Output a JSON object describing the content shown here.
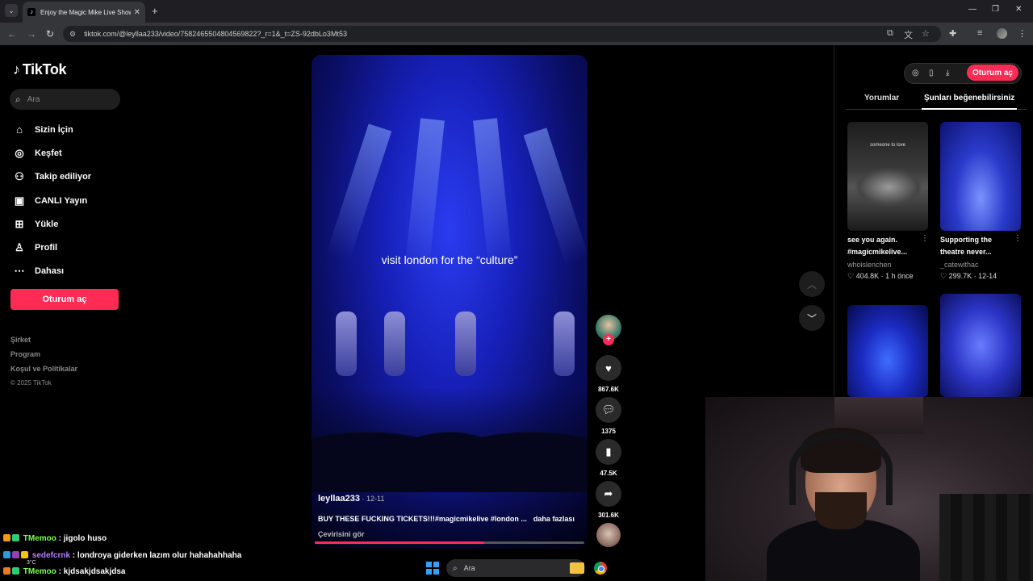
{
  "browser": {
    "tab_title": "Enjoy the Magic Mike Live Show",
    "url": "tiktok.com/@leyllaa233/video/7582465504804569822?_r=1&_t=ZS-92dbLo3Mt53"
  },
  "sidebar": {
    "logo": "TikTok",
    "search_placeholder": "Ara",
    "items": [
      {
        "label": "Sizin İçin",
        "icon": "home-icon"
      },
      {
        "label": "Keşfet",
        "icon": "compass-icon"
      },
      {
        "label": "Takip ediliyor",
        "icon": "following-icon"
      },
      {
        "label": "CANLI Yayın",
        "icon": "live-icon"
      },
      {
        "label": "Yükle",
        "icon": "upload-icon"
      },
      {
        "label": "Profil",
        "icon": "profile-icon"
      },
      {
        "label": "Dahası",
        "icon": "more-icon"
      }
    ],
    "login_button": "Oturum aç",
    "footer": [
      "Şirket",
      "Program",
      "Koşul ve Politikalar"
    ],
    "copyright": "© 2025 TikTok"
  },
  "video": {
    "overlay_text": "visit london for the “culture”",
    "username": "leyllaa233",
    "date": "12-11",
    "caption": "BUY THESE FUCKING TICKETS!!!#magicmikelive #london ...",
    "more_label": "daha fazlası",
    "translate_label": "Çevirisini gör",
    "progress": 0.63
  },
  "actions": {
    "likes": "867.6K",
    "comments": "1375",
    "saves": "47.5K",
    "shares": "301.6K"
  },
  "right_panel": {
    "login_button": "Oturum aç",
    "tabs": [
      "Yorumlar",
      "Şunları beğenebilirsiniz"
    ],
    "cards": [
      {
        "title1": "see you again.",
        "title2": "#magicmikelive...",
        "author": "whoislenchen",
        "likes": "404.8K",
        "date": "1 h önce",
        "thumb_text": "someone to love",
        "tone": "grey"
      },
      {
        "title1": "Supporting the",
        "title2": "theatre never...",
        "author": "_catewithac",
        "likes": "299.7K",
        "date": "12-14",
        "tone": "blue"
      },
      {
        "tone": "blue-stage"
      },
      {
        "tone": "blue-dancers"
      }
    ]
  },
  "chat": [
    {
      "user": "TMemoo",
      "message": "jigolo huso",
      "color": "#7cff4f"
    },
    {
      "user": "sedefcrnk",
      "message": "londroya giderken lazım olur hahahahhaha",
      "color": "#b67cff"
    },
    {
      "user": "TMemoo",
      "message": "kjdsakjdsakjdsa",
      "color": "#7cff4f"
    }
  ],
  "taskbar": {
    "search_placeholder": "Ara",
    "temperature": "3°C"
  }
}
